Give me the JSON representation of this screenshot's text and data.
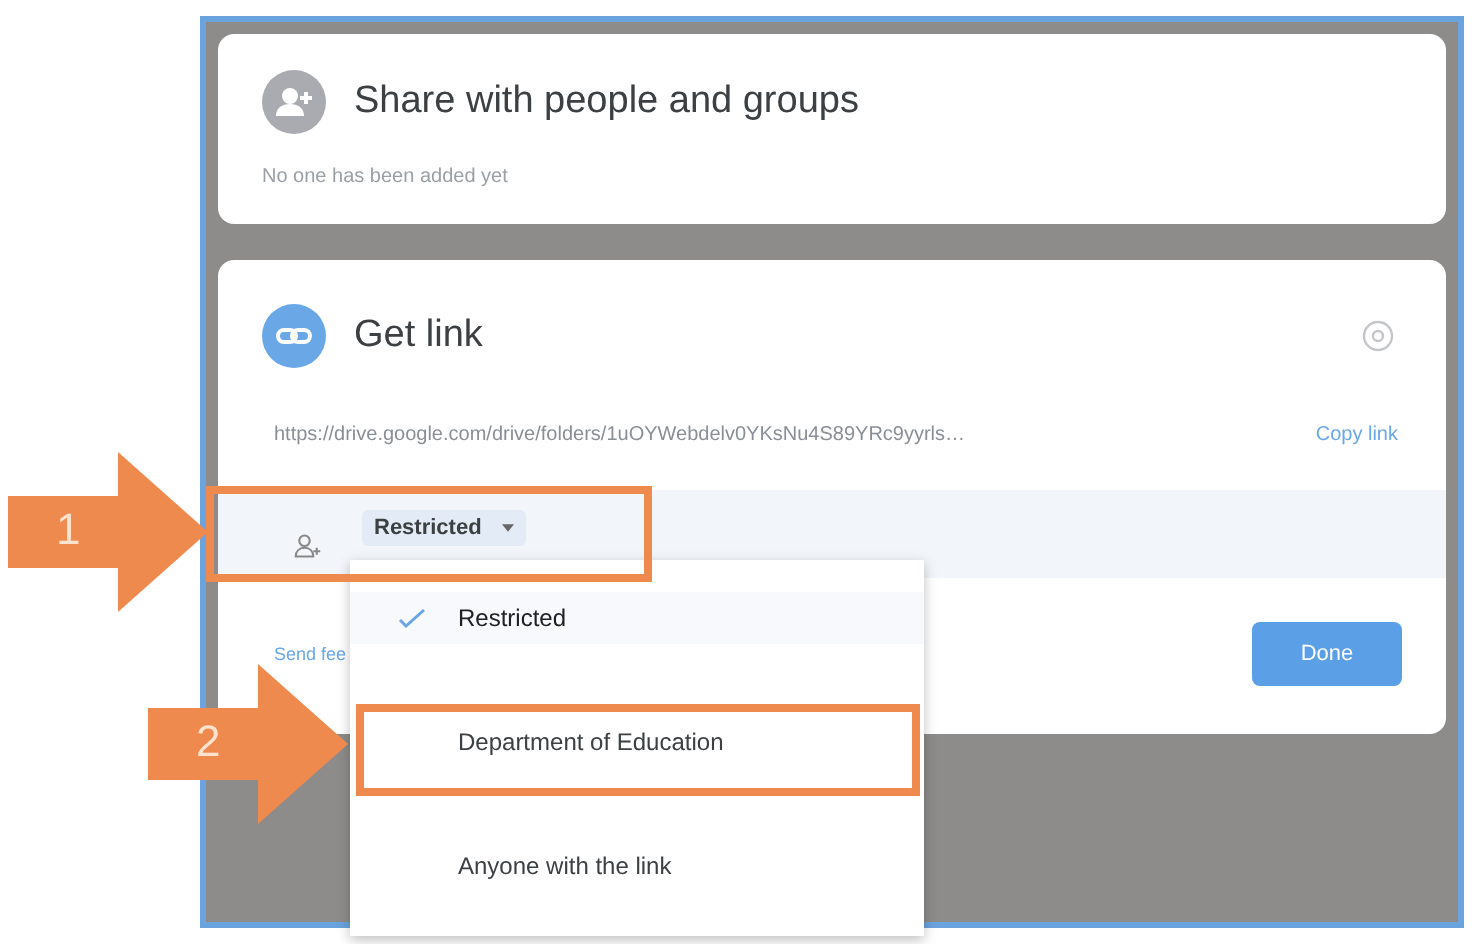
{
  "share_card": {
    "title": "Share with people and groups",
    "subtitle": "No one has been added yet"
  },
  "link_card": {
    "title": "Get link",
    "url": "https://drive.google.com/drive/folders/1uOYWebdelv0YKsNu4S89YRc9yyrls…",
    "copy_label": "Copy link",
    "access": {
      "label": "Restricted",
      "expanded": true
    },
    "send_feedback": "Send fee",
    "done_label": "Done"
  },
  "access_menu": [
    {
      "label": "Restricted",
      "selected": true
    },
    {
      "label": "Department of Education",
      "selected": false
    },
    {
      "label": "Anyone with the link",
      "selected": false
    }
  ],
  "annotations": [
    {
      "number": "1"
    },
    {
      "number": "2"
    }
  ]
}
